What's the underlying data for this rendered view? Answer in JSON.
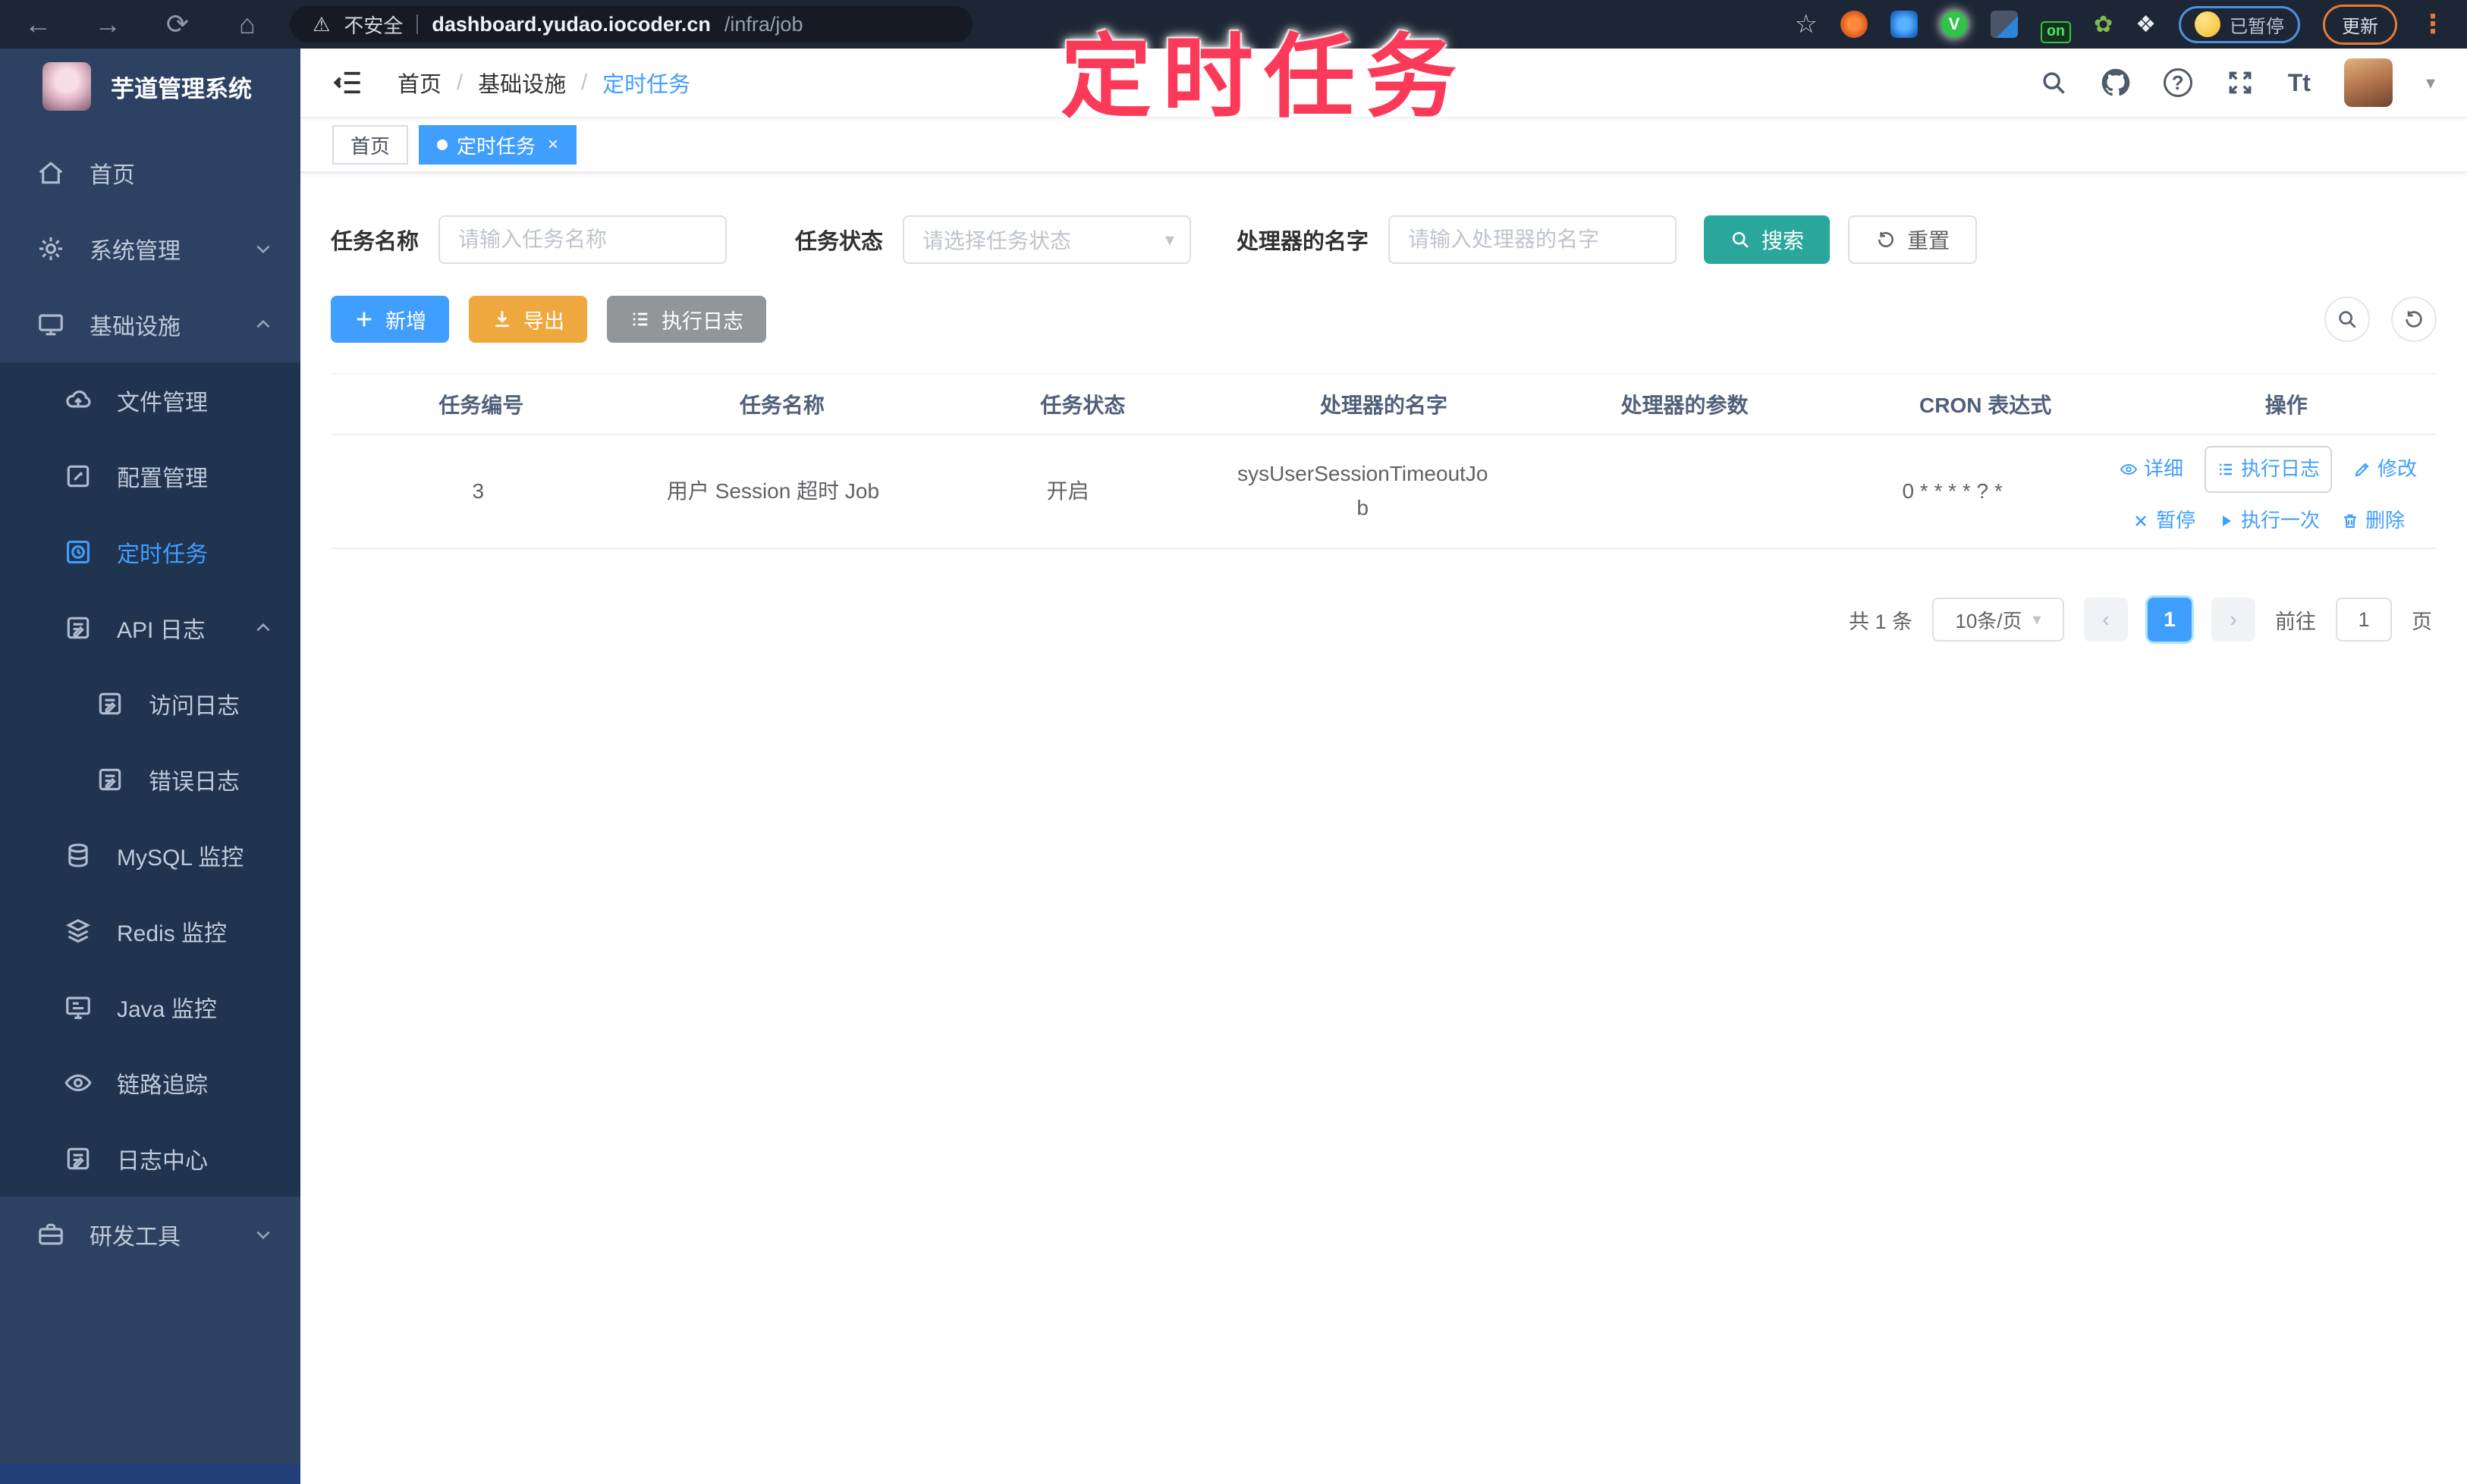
{
  "watermark": "定时任务",
  "browser": {
    "security_warning": "不安全",
    "url_domain": "dashboard.yudao.iocoder.cn",
    "url_path": "/infra/job",
    "on_badge": "on",
    "paused_label": "已暂停",
    "update_label": "更新"
  },
  "sidebar": {
    "app_title": "芋道管理系统",
    "items": [
      {
        "label": "首页",
        "icon": "home-icon",
        "level": 1
      },
      {
        "label": "系统管理",
        "icon": "gear-icon",
        "level": 1,
        "chevron": "down"
      },
      {
        "label": "基础设施",
        "icon": "monitor-icon",
        "level": 1,
        "chevron": "up"
      },
      {
        "label": "文件管理",
        "icon": "cloud-upload-icon",
        "level": 2
      },
      {
        "label": "配置管理",
        "icon": "edit-square-icon",
        "level": 2
      },
      {
        "label": "定时任务",
        "icon": "timer-icon",
        "level": 2,
        "active": true
      },
      {
        "label": "API 日志",
        "icon": "log-edit-icon",
        "level": 2,
        "chevron": "up"
      },
      {
        "label": "访问日志",
        "icon": "log-edit-icon",
        "level": 3
      },
      {
        "label": "错误日志",
        "icon": "log-edit-icon",
        "level": 3
      },
      {
        "label": "MySQL 监控",
        "icon": "database-icon",
        "level": 2
      },
      {
        "label": "Redis 监控",
        "icon": "stack-icon",
        "level": 2
      },
      {
        "label": "Java 监控",
        "icon": "screen-icon",
        "level": 2
      },
      {
        "label": "链路追踪",
        "icon": "eye-icon",
        "level": 2
      },
      {
        "label": "日志中心",
        "icon": "log-edit-icon",
        "level": 2
      },
      {
        "label": "研发工具",
        "icon": "briefcase-icon",
        "level": 1,
        "chevron": "down"
      }
    ]
  },
  "header": {
    "breadcrumb": [
      "首页",
      "基础设施",
      "定时任务"
    ],
    "font_icon_text": "Tt"
  },
  "tags": {
    "home": "首页",
    "active": "定时任务"
  },
  "filters": {
    "name_label": "任务名称",
    "name_placeholder": "请输入任务名称",
    "status_label": "任务状态",
    "status_placeholder": "请选择任务状态",
    "handler_label": "处理器的名字",
    "handler_placeholder": "请输入处理器的名字",
    "search_label": "搜索",
    "reset_label": "重置"
  },
  "toolbar": {
    "add_label": "新增",
    "export_label": "导出",
    "exec_log_label": "执行日志"
  },
  "table": {
    "headers": [
      "任务编号",
      "任务名称",
      "任务状态",
      "处理器的名字",
      "处理器的参数",
      "CRON 表达式",
      "操作"
    ],
    "rows": [
      {
        "id": "3",
        "name": "用户 Session 超时 Job",
        "status": "开启",
        "handler": "sysUserSessionTimeoutJob",
        "params": "",
        "cron": "0 * * * * ? *",
        "actions_row1": [
          "详细",
          "执行日志",
          "修改"
        ],
        "actions_row2": [
          "暂停",
          "执行一次",
          "删除"
        ]
      }
    ]
  },
  "pagination": {
    "total_text": "共 1 条",
    "page_size": "10条/页",
    "current_page": "1",
    "goto_label": "前往",
    "goto_value": "1",
    "page_unit": "页"
  },
  "colors": {
    "primary": "#409eff",
    "search_teal": "#2aa79b",
    "export_amber": "#efa83e",
    "info_gray": "#939699",
    "watermark_pink": "#fb3a5a",
    "sidebar_bg": "#2d4263",
    "submenu_bg": "#20334f"
  }
}
